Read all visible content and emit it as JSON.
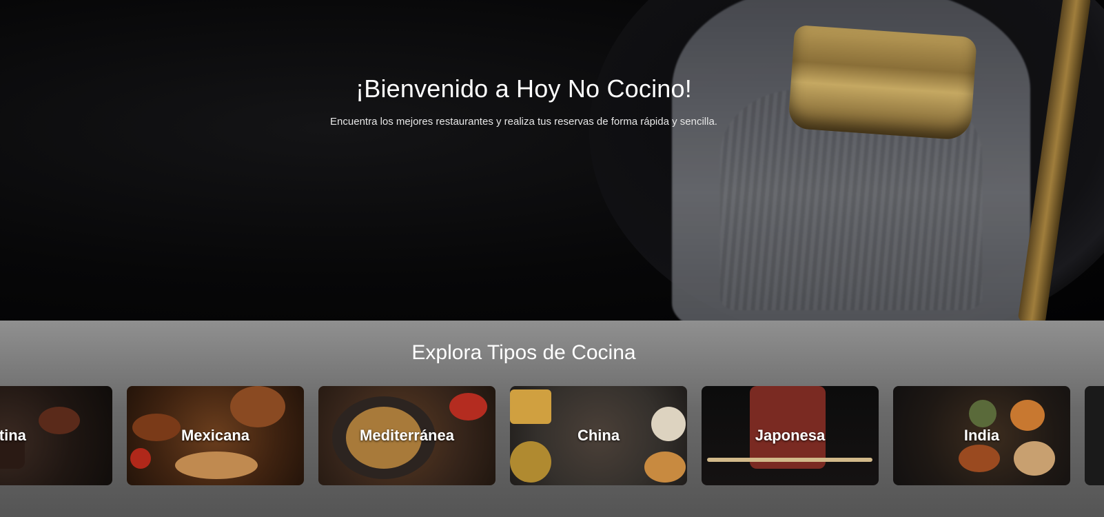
{
  "hero": {
    "title": "¡Bienvenido a Hoy No Cocino!",
    "subtitle": "Encuentra los mejores restaurantes y realiza tus reservas de forma rápida y sencilla."
  },
  "explore": {
    "title": "Explora Tipos de Cocina",
    "cuisines": [
      {
        "label": "Argentina",
        "visible_label": "rgentina"
      },
      {
        "label": "Mexicana"
      },
      {
        "label": "Mediterránea"
      },
      {
        "label": "China"
      },
      {
        "label": "Japonesa"
      },
      {
        "label": "India"
      },
      {
        "label": ""
      }
    ]
  },
  "colors": {
    "hero_background": "#050506",
    "section_background": "#6a6a6a",
    "text": "#ffffff"
  }
}
